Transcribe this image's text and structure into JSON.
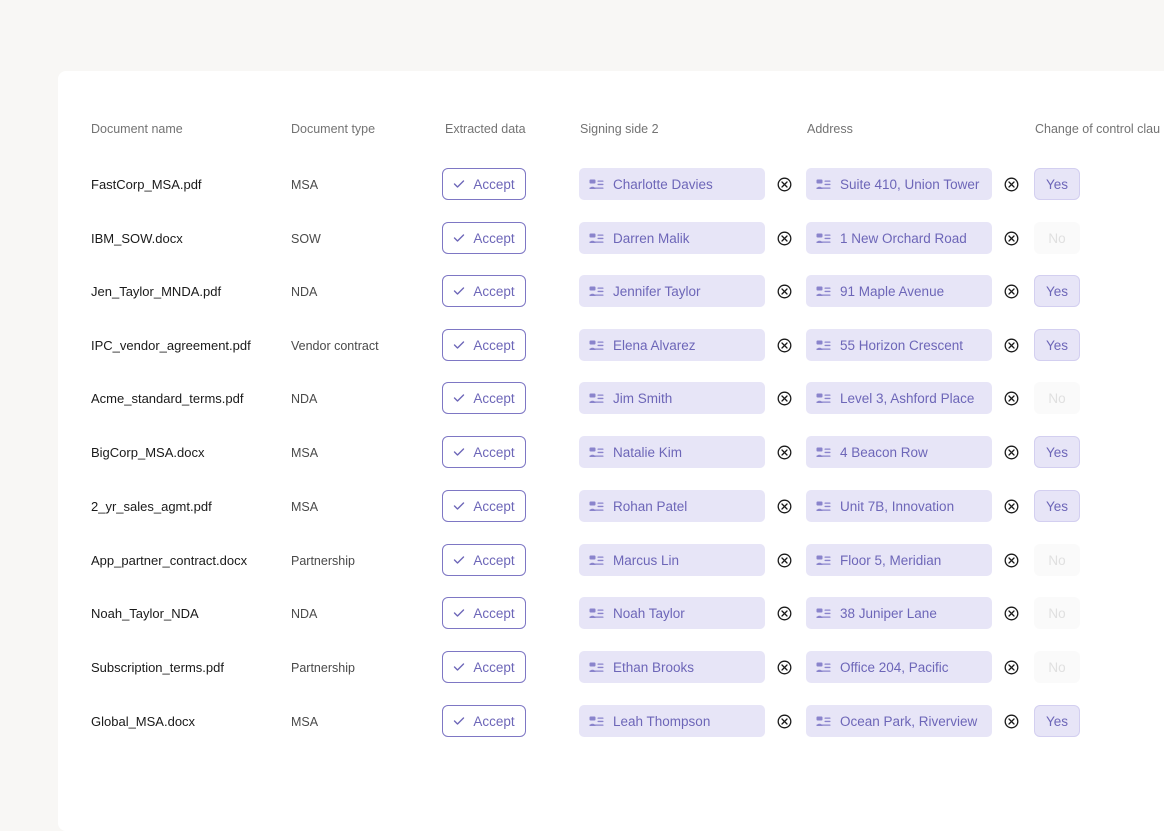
{
  "headers": {
    "document_name": "Document name",
    "document_type": "Document type",
    "extracted_data": "Extracted data",
    "signing_side_2": "Signing side 2",
    "address": "Address",
    "change_of_control": "Change of control clau"
  },
  "accept_label": "Accept",
  "colors": {
    "accent": "#6d66b8",
    "pill_bg": "#e7e5f7",
    "accept_border": "#7e77c4"
  },
  "rows": [
    {
      "name": "FastCorp_MSA.pdf",
      "type": "MSA",
      "signer": "Charlotte Davies",
      "address": "Suite 410, Union Tower",
      "coc": "Yes"
    },
    {
      "name": "IBM_SOW.docx",
      "type": "SOW",
      "signer": "Darren Malik",
      "address": "1 New Orchard Road",
      "coc": "No"
    },
    {
      "name": "Jen_Taylor_MNDA.pdf",
      "type": "NDA",
      "signer": "Jennifer Taylor",
      "address": "91 Maple Avenue",
      "coc": "Yes"
    },
    {
      "name": "IPC_vendor_agreement.pdf",
      "type": "Vendor contract",
      "signer": "Elena Alvarez",
      "address": "55 Horizon Crescent",
      "coc": "Yes"
    },
    {
      "name": "Acme_standard_terms.pdf",
      "type": "NDA",
      "signer": "Jim Smith",
      "address": "Level 3, Ashford Place",
      "coc": "No"
    },
    {
      "name": "BigCorp_MSA.docx",
      "type": "MSA",
      "signer": "Natalie Kim",
      "address": "4 Beacon Row",
      "coc": "Yes"
    },
    {
      "name": "2_yr_sales_agmt.pdf",
      "type": "MSA",
      "signer": "Rohan Patel",
      "address": "Unit 7B, Innovation",
      "coc": "Yes"
    },
    {
      "name": "App_partner_contract.docx",
      "type": "Partnership",
      "signer": "Marcus Lin",
      "address": "Floor 5, Meridian",
      "coc": "No"
    },
    {
      "name": "Noah_Taylor_NDA",
      "type": "NDA",
      "signer": "Noah Taylor",
      "address": "38 Juniper Lane",
      "coc": "No"
    },
    {
      "name": "Subscription_terms.pdf",
      "type": "Partnership",
      "signer": "Ethan Brooks",
      "address": "Office 204, Pacific",
      "coc": "No"
    },
    {
      "name": "Global_MSA.docx",
      "type": "MSA",
      "signer": "Leah Thompson",
      "address": "Ocean Park, Riverview",
      "coc": "Yes"
    }
  ]
}
